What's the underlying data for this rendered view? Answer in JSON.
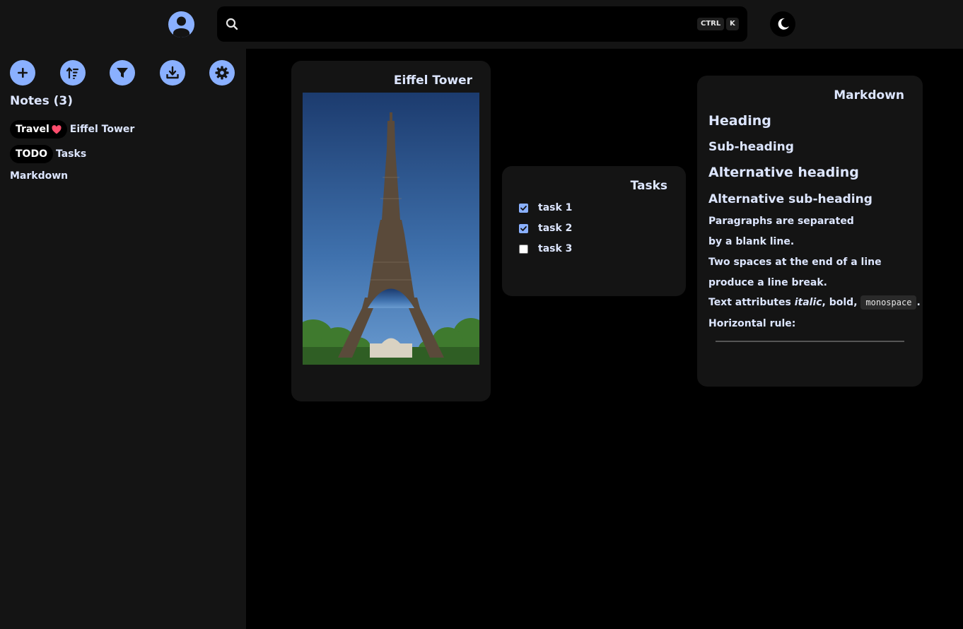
{
  "search": {
    "placeholder": "",
    "shortcut_keys": [
      "CTRL",
      "K"
    ]
  },
  "toolbar": {
    "buttons": [
      {
        "name": "add-note-button",
        "icon": "plus-icon"
      },
      {
        "name": "sort-button",
        "icon": "sort-icon"
      },
      {
        "name": "filter-button",
        "icon": "filter-icon"
      },
      {
        "name": "download-button",
        "icon": "download-icon"
      },
      {
        "name": "settings-button",
        "icon": "gear-icon"
      }
    ]
  },
  "notes": {
    "title": "Notes (3)",
    "items": [
      {
        "tag": "Travel",
        "tag_icon": "heart-icon",
        "name": "Eiffel Tower"
      },
      {
        "tag": "TODO",
        "name": "Tasks"
      },
      {
        "name": "Markdown"
      }
    ]
  },
  "cards": {
    "eiffel": {
      "title": "Eiffel Tower"
    },
    "tasks": {
      "title": "Tasks",
      "items": [
        {
          "label": "task 1",
          "checked": true
        },
        {
          "label": "task 2",
          "checked": true
        },
        {
          "label": "task 3",
          "checked": false
        }
      ]
    },
    "markdown": {
      "title": "Markdown",
      "heading": "Heading",
      "subheading": "Sub-heading",
      "alt_heading": "Alternative heading",
      "alt_subheading": "Alternative sub-heading",
      "para1_line1": "Paragraphs are separated",
      "para1_line2": "by a blank line.",
      "para2_line1": "Two spaces at the end of a line",
      "para2_line2": "produce a line break.",
      "attrs_prefix": "Text attributes ",
      "attrs_italic": "italic",
      "attrs_mid": ", bold, ",
      "attrs_mono": "monospace",
      "attrs_end": ".",
      "hr_label": "Horizontal rule:"
    }
  },
  "colors": {
    "accent": "#8ab0ff",
    "panel": "#141414",
    "background": "#000000",
    "heart": "#ff4d6d"
  }
}
